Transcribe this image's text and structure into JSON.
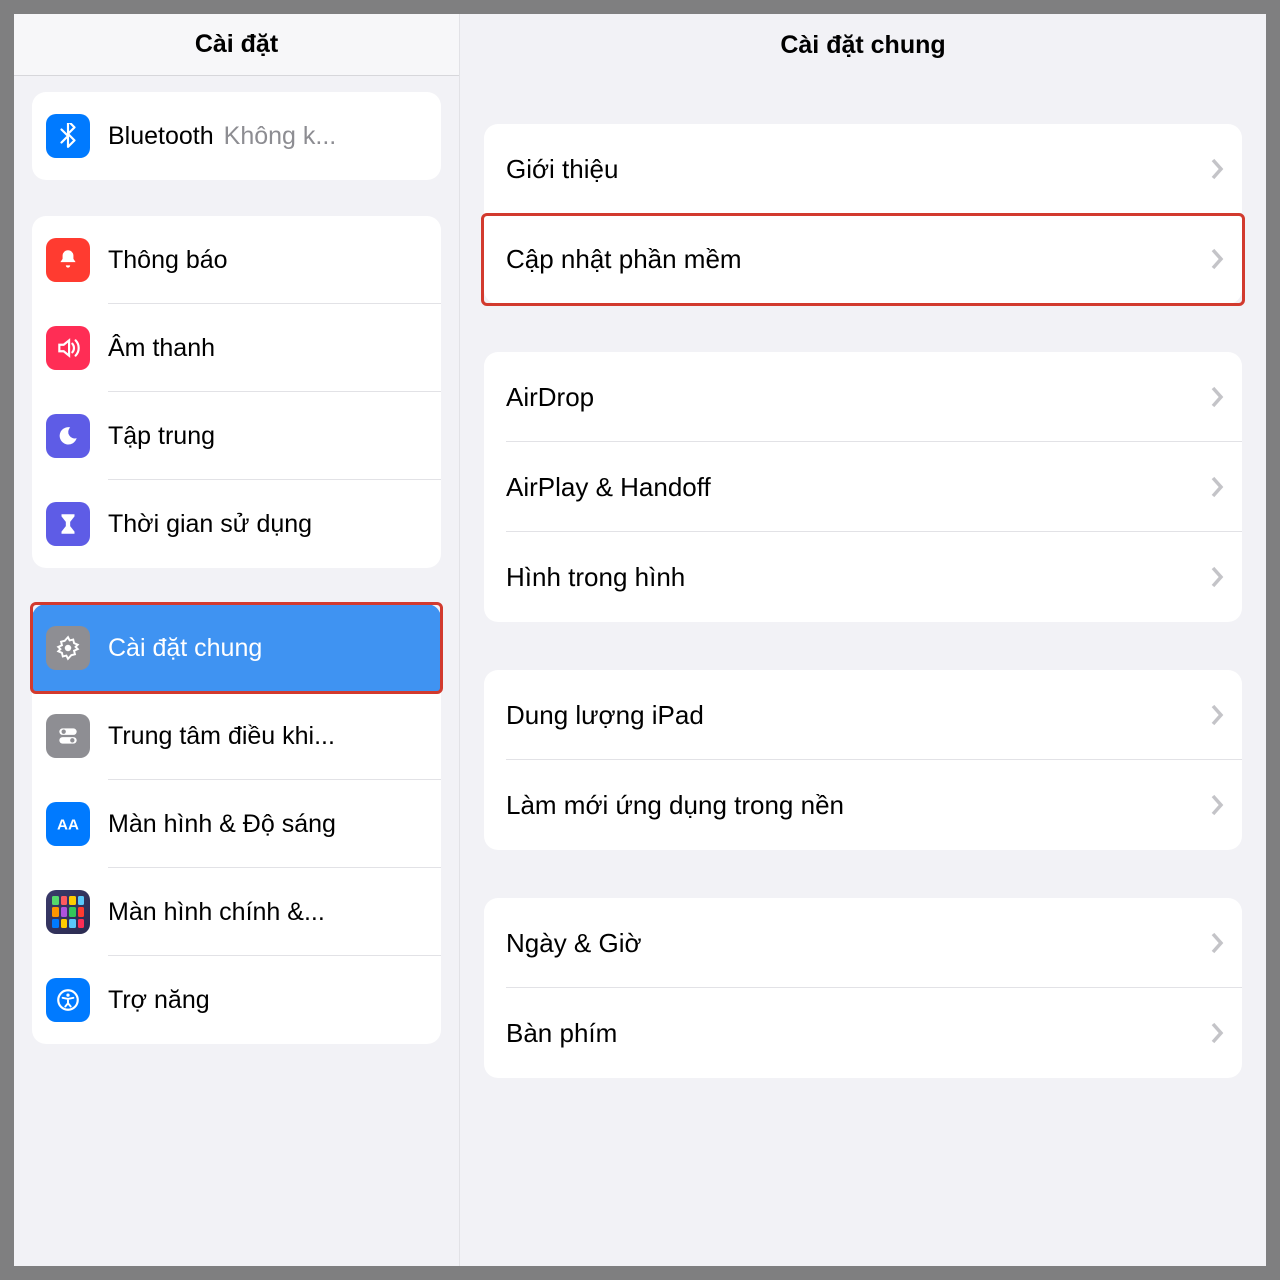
{
  "sidebar": {
    "title": "Cài đặt",
    "groups": [
      {
        "rows": [
          {
            "id": "bluetooth",
            "label": "Bluetooth",
            "value": "Không k..."
          }
        ]
      },
      {
        "rows": [
          {
            "id": "notifications",
            "label": "Thông báo"
          },
          {
            "id": "sound",
            "label": "Âm thanh"
          },
          {
            "id": "focus",
            "label": "Tập trung"
          },
          {
            "id": "screentime",
            "label": "Thời gian sử dụng"
          }
        ]
      },
      {
        "rows": [
          {
            "id": "general",
            "label": "Cài đặt chung",
            "selected": true,
            "highlighted": true
          },
          {
            "id": "controlcenter",
            "label": "Trung tâm điều khi..."
          },
          {
            "id": "display",
            "label": "Màn hình & Độ sáng"
          },
          {
            "id": "homescreen",
            "label": "Màn hình chính &..."
          },
          {
            "id": "accessibility",
            "label": "Trợ năng"
          }
        ]
      }
    ]
  },
  "detail": {
    "title": "Cài đặt chung",
    "groups": [
      {
        "rows": [
          {
            "id": "about",
            "label": "Giới thiệu"
          },
          {
            "id": "software-update",
            "label": "Cập nhật phần mềm",
            "highlighted": true
          }
        ]
      },
      {
        "rows": [
          {
            "id": "airdrop",
            "label": "AirDrop"
          },
          {
            "id": "airplay",
            "label": "AirPlay & Handoff"
          },
          {
            "id": "pip",
            "label": "Hình trong hình"
          }
        ]
      },
      {
        "rows": [
          {
            "id": "storage",
            "label": "Dung lượng iPad"
          },
          {
            "id": "bgrefresh",
            "label": "Làm mới ứng dụng trong nền"
          }
        ]
      },
      {
        "rows": [
          {
            "id": "datetime",
            "label": "Ngày & Giờ"
          },
          {
            "id": "keyboard",
            "label": "Bàn phím"
          }
        ]
      }
    ]
  },
  "homescreen_colors": [
    "#55d86b",
    "#ff5a5f",
    "#ffcc00",
    "#5ac8fa",
    "#ff9500",
    "#af52de",
    "#34c759",
    "#ff3b30",
    "#007aff",
    "#ffcc00",
    "#5ac8fa",
    "#ff2d55"
  ]
}
